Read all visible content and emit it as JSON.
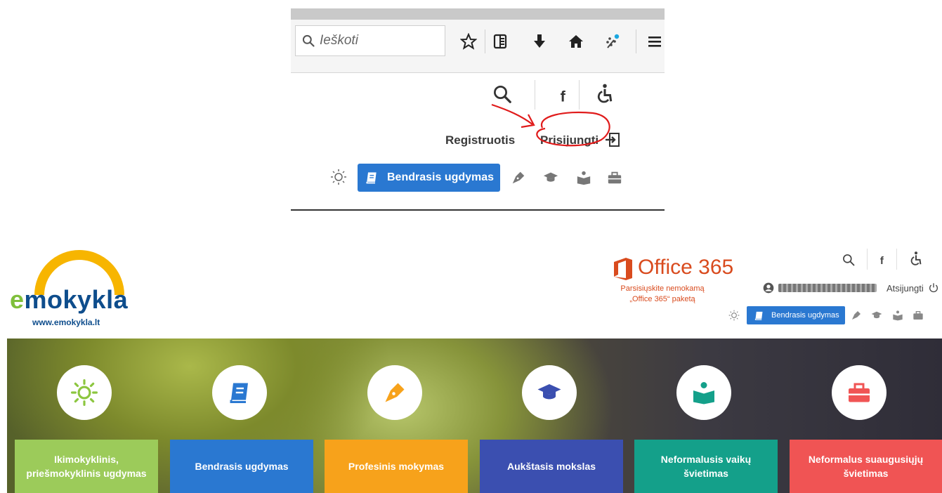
{
  "browser": {
    "search_placeholder": "Ieškoti",
    "buttons": [
      "bookmark-star",
      "reading-list",
      "downloads",
      "home",
      "extension",
      "menu"
    ]
  },
  "zoom_header": {
    "register_label": "Registruotis",
    "login_label": "Prisijungti",
    "active_section": "Bendrasis ugdymas",
    "annotation": "red hand-drawn arrow and circle around Prisijungti"
  },
  "site": {
    "logo_e": "e",
    "logo_rest": "mokykla",
    "logo_url": "www.emokykla.lt",
    "office_name": "Office 365",
    "office_line1": "Parsisiųskite nemokamą",
    "office_line2": "„Office 365“ paketą",
    "logout_label": "Atsijungti",
    "active_section": "Bendrasis ugdymas"
  },
  "sections": [
    {
      "label_1": "Ikimokyklinis,",
      "label_2": "priešmokyklinis ugdymas",
      "color": "#9ccb5a",
      "icon": "sun-icon"
    },
    {
      "label_1": "Bendrasis ugdymas",
      "label_2": "",
      "color": "#2a78d1",
      "icon": "book-icon"
    },
    {
      "label_1": "Profesinis mokymas",
      "label_2": "",
      "color": "#f7a21b",
      "icon": "pen-icon"
    },
    {
      "label_1": "Aukštasis mokslas",
      "label_2": "",
      "color": "#3b4fb0",
      "icon": "graduation-cap-icon"
    },
    {
      "label_1": "Neformalusis vaikų",
      "label_2": "švietimas",
      "color": "#14a08a",
      "icon": "reader-icon"
    },
    {
      "label_1": "Neformalus suaugusiųjų",
      "label_2": "švietimas",
      "color": "#f05454",
      "icon": "briefcase-icon"
    }
  ]
}
